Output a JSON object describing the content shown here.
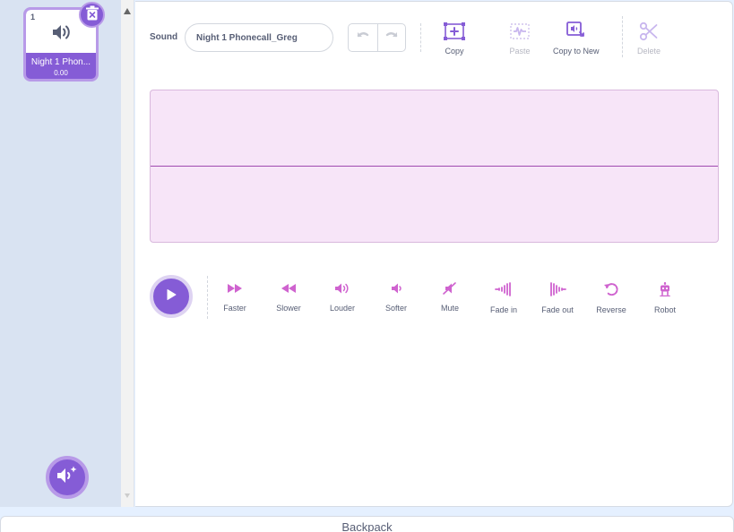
{
  "sound_list": {
    "items": [
      {
        "index": "1",
        "name": "Night 1 Phon...",
        "duration": "0.00",
        "selected": true
      }
    ]
  },
  "editor": {
    "sound_label": "Sound",
    "sound_name_value": "Night 1 Phonecall_Greg",
    "tools": {
      "copy": "Copy",
      "paste": "Paste",
      "copy_to_new": "Copy to New",
      "delete": "Delete"
    },
    "effects": {
      "faster": "Faster",
      "slower": "Slower",
      "louder": "Louder",
      "softer": "Softer",
      "mute": "Mute",
      "fade_in": "Fade in",
      "fade_out": "Fade out",
      "reverse": "Reverse",
      "robot": "Robot"
    }
  },
  "backpack": {
    "label": "Backpack"
  },
  "colors": {
    "accent": "#855cd6",
    "accent_light": "#b89ae8",
    "effect_icon": "#cf63cf",
    "waveform_bg": "#f7e5f8",
    "waveform_line": "#a04ab0",
    "text": "#575e75",
    "disabled_text": "#b6b7c2"
  }
}
